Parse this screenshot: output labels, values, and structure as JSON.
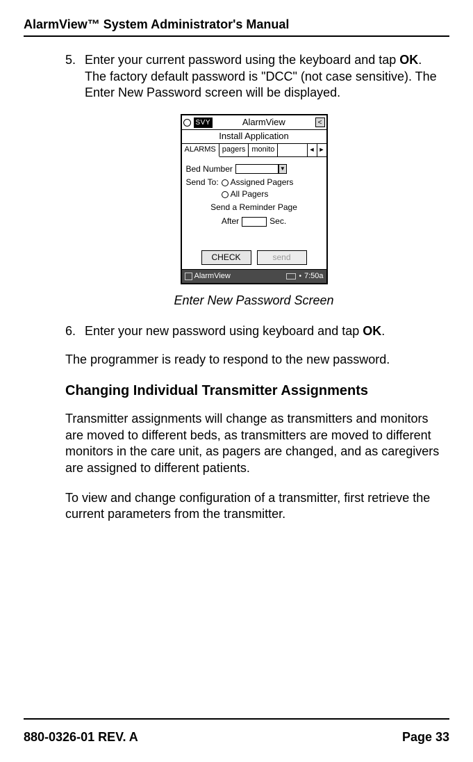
{
  "header": {
    "title": "AlarmView™ System Administrator's Manual"
  },
  "step5": {
    "num": "5.",
    "t1": "Enter your current password using the keyboard and tap ",
    "ok": "OK",
    "t2": ". The factory default password is \"DCC\" (not case sensitive). The Enter New Password screen will be displayed."
  },
  "device": {
    "svy": "SVY",
    "app": "AlarmView",
    "back": "<",
    "install": "Install Application",
    "tabs": {
      "alarms": "ALARMS",
      "pagers": "pagers",
      "monitor": "monito"
    },
    "arrows": {
      "left": "◄",
      "right": "►"
    },
    "body": {
      "bed_label": "Bed Number",
      "drop_glyph": "▼",
      "sendto_label": "Send To:",
      "opt_assigned": "Assigned Pagers",
      "opt_all": "All Pagers",
      "reminder": "Send a Reminder Page",
      "after": "After",
      "sec": "Sec."
    },
    "buttons": {
      "check": "CHECK",
      "send": "send"
    },
    "taskbar": {
      "app": "AlarmView",
      "time": "7:50a"
    }
  },
  "caption": "Enter New Password Screen",
  "step6": {
    "num": "6.",
    "t1": "Enter your new password using keyboard and tap ",
    "ok": "OK",
    "t2": "."
  },
  "para_ready": "The programmer is ready to respond to the new password.",
  "section_title": "Changing Individual Transmitter Assignments",
  "para_assign": "Transmitter assignments will change as transmitters and monitors are moved to different beds, as transmitters are moved to different monitors in the care unit, as pagers are changed, and as caregivers are assigned to different patients.",
  "para_view": "To view and change configuration of a transmitter, first retrieve the current parameters from the transmitter.",
  "footer": {
    "left": "880-0326-01 REV. A",
    "right": "Page 33"
  }
}
